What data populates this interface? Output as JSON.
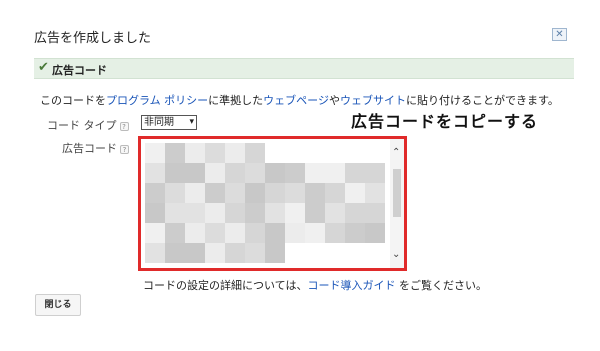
{
  "dialog": {
    "title": "広告を作成しました",
    "close_icon": "close-icon"
  },
  "section": {
    "check_icon": "check-icon",
    "label": "広告コード"
  },
  "description": {
    "prefix": "このコードを",
    "link1": "プログラム ポリシー",
    "middle": "に準拠した",
    "link2": "ウェブページ",
    "conj": "や",
    "link3": "ウェブサイト",
    "suffix": "に貼り付けることができます。"
  },
  "code_type": {
    "label": "コード タイプ",
    "help": "?",
    "selected": "非同期",
    "arrow": "▾"
  },
  "ad_code": {
    "label": "広告コード",
    "help": "?",
    "scroll_up": "⌃",
    "scroll_down": "⌄"
  },
  "annotation": "広告コードをコピーする",
  "guide": {
    "prefix": "コードの設定の詳細については、",
    "link": "コード導入ガイド",
    "suffix": " をご覧ください。"
  },
  "footer": {
    "close_label": "閉じる"
  },
  "colors": {
    "highlight_border": "#e02a2a",
    "link": "#1a55b8",
    "section_bg": "#e5f0e5"
  }
}
